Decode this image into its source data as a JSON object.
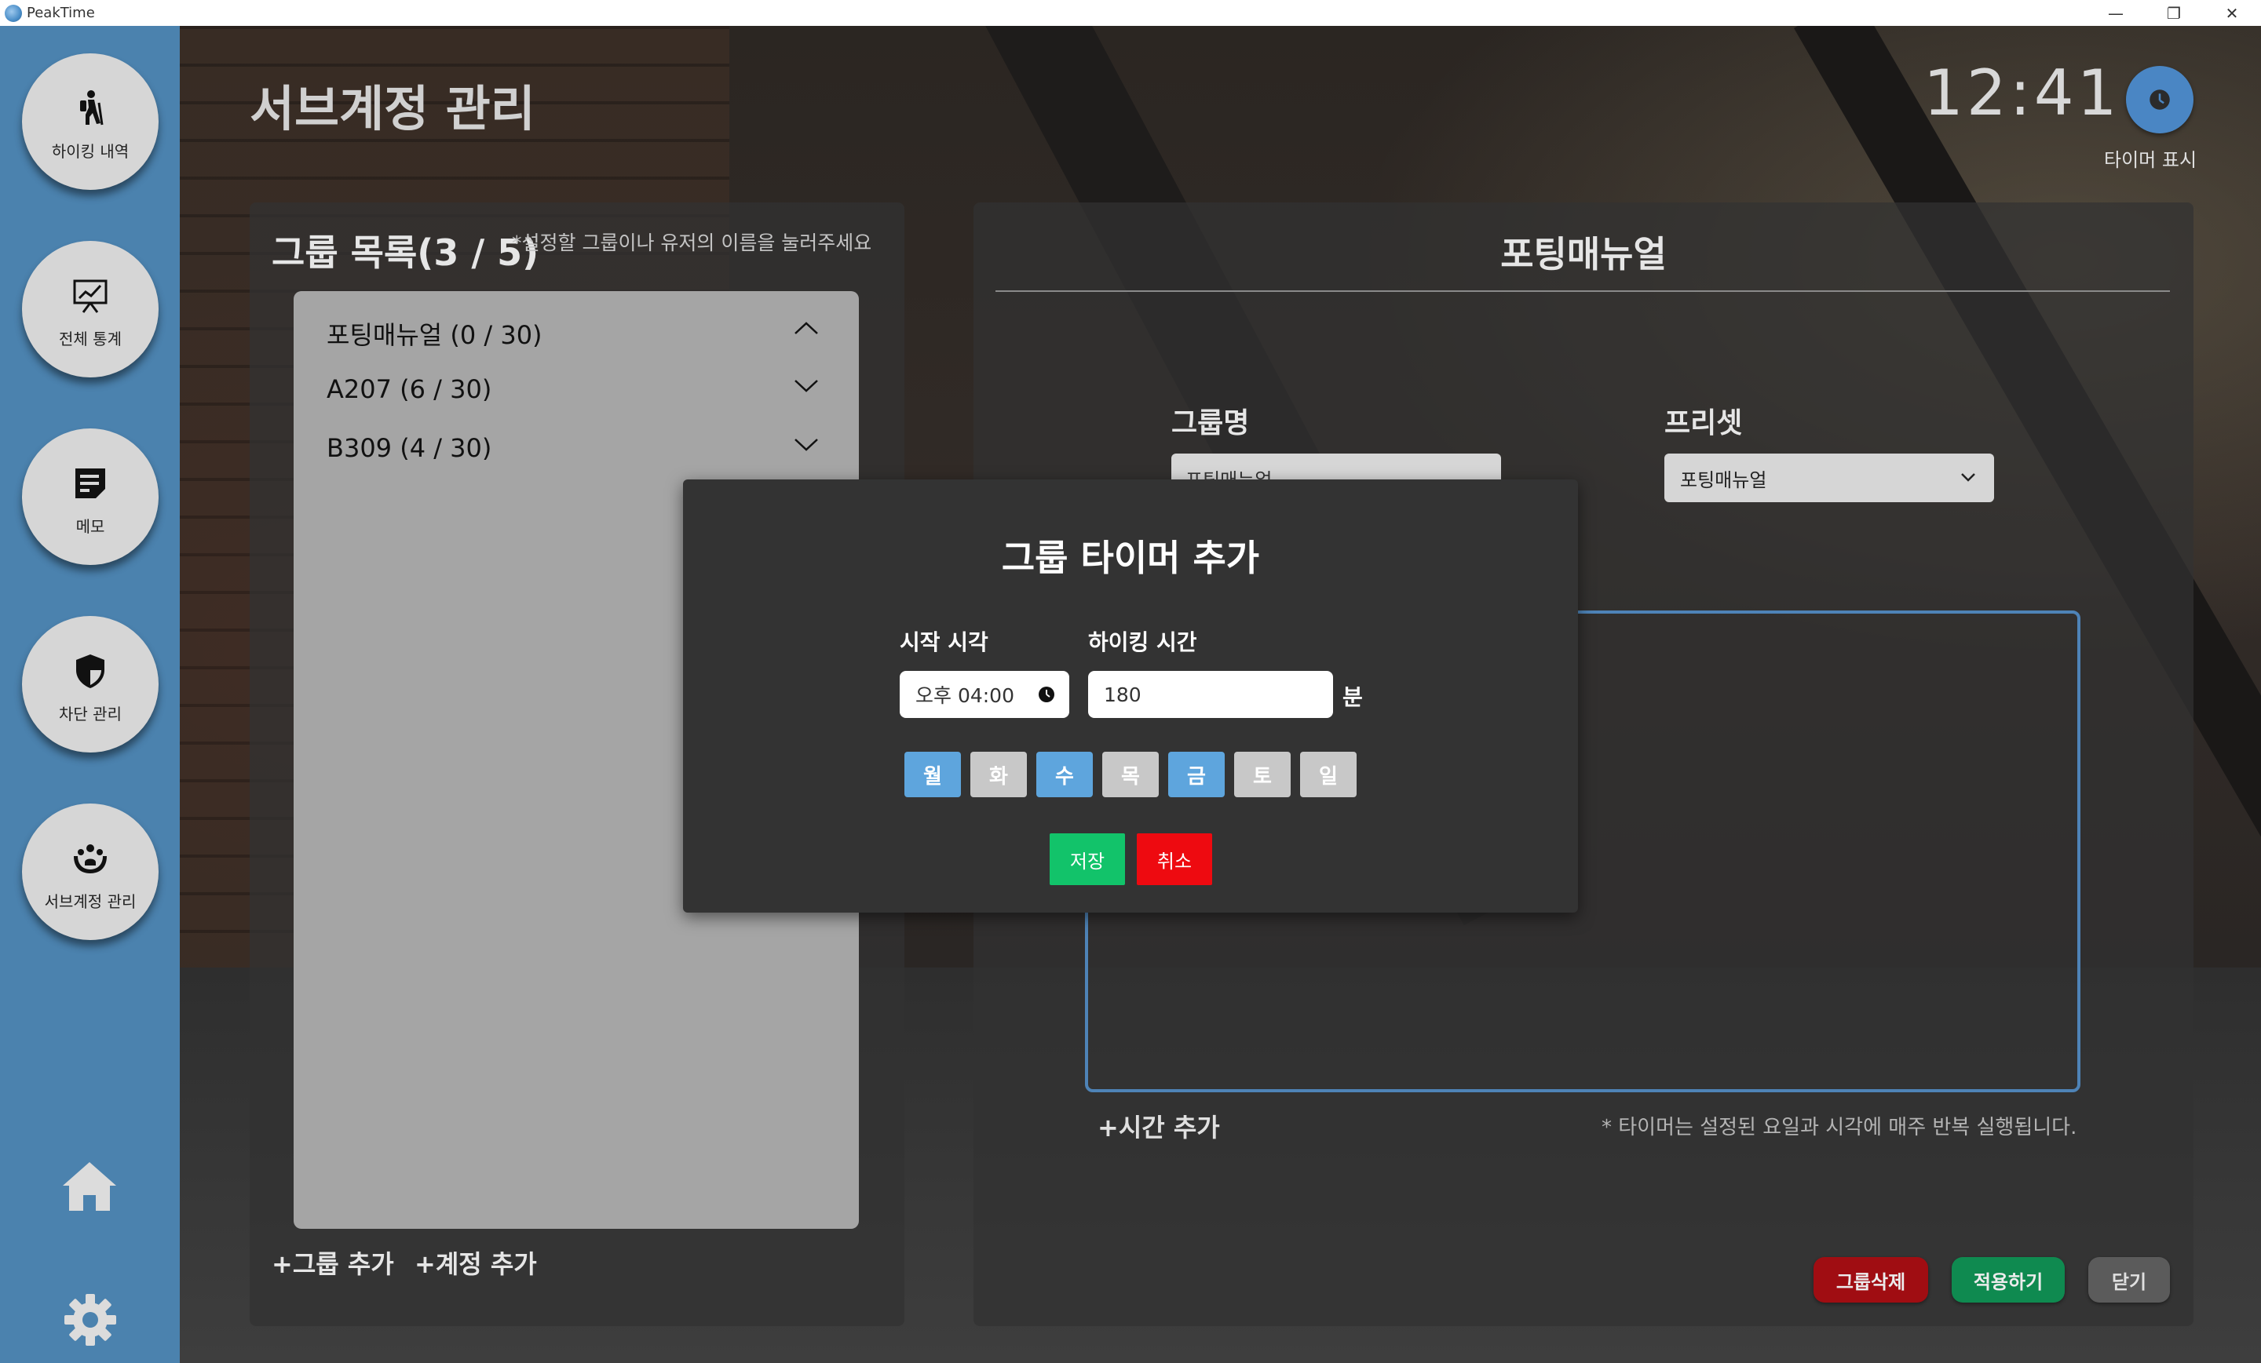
{
  "window": {
    "app_name": "PeakTime",
    "minimize": "—",
    "restore": "❐",
    "close": "✕"
  },
  "sidebar": {
    "items": [
      {
        "label": "하이킹 내역",
        "icon": "hiking-icon"
      },
      {
        "label": "전체 통계",
        "icon": "chart-board-icon"
      },
      {
        "label": "메모",
        "icon": "memo-icon"
      },
      {
        "label": "차단 관리",
        "icon": "shield-icon"
      },
      {
        "label": "서브계정 관리",
        "icon": "group-hands-icon"
      }
    ],
    "home_icon": "home-icon",
    "settings_icon": "gear-icon"
  },
  "header": {
    "title": "서브계정 관리",
    "clock": "12:41",
    "timer_label": "타이머 표시"
  },
  "group_list": {
    "title": "그룹 목록(3 / 5)",
    "hint": "*설정할 그룹이나 유저의 이름을 눌러주세요",
    "groups": [
      {
        "name": "포팅매뉴얼 (0 / 30)",
        "expanded": true
      },
      {
        "name": "A207 (6 / 30)",
        "expanded": false
      },
      {
        "name": "B309 (4 / 30)",
        "expanded": false
      }
    ],
    "add_group": "+그룹 추가",
    "add_account": "+계정 추가"
  },
  "detail": {
    "title": "포팅매뉴얼",
    "group_name_label": "그룹명",
    "group_name_value": "포팅매뉴얼",
    "preset_label": "프리셋",
    "preset_value": "포팅매뉴얼",
    "add_time": "+시간 추가",
    "note": "* 타이머는 설정된 요일과 시각에 매주 반복 실행됩니다.",
    "delete_button": "그룹삭제",
    "apply_button": "적용하기",
    "close_button": "닫기"
  },
  "modal": {
    "title": "그룹 타이머 추가",
    "start_label": "시작 시각",
    "start_value": "오후 04:00",
    "duration_label": "하이킹 시간",
    "duration_value": "180",
    "unit": "분",
    "days": [
      {
        "label": "월",
        "selected": true
      },
      {
        "label": "화",
        "selected": false
      },
      {
        "label": "수",
        "selected": true
      },
      {
        "label": "목",
        "selected": false
      },
      {
        "label": "금",
        "selected": true
      },
      {
        "label": "토",
        "selected": false
      },
      {
        "label": "일",
        "selected": false
      }
    ],
    "save": "저장",
    "cancel": "취소"
  },
  "colors": {
    "sidebar": "#4b82ae",
    "accent_blue": "#5ea5dd",
    "save_green": "#12c36a",
    "cancel_red": "#ee0a10",
    "delete_red": "#a00d12",
    "apply_green": "#0f8a50"
  }
}
